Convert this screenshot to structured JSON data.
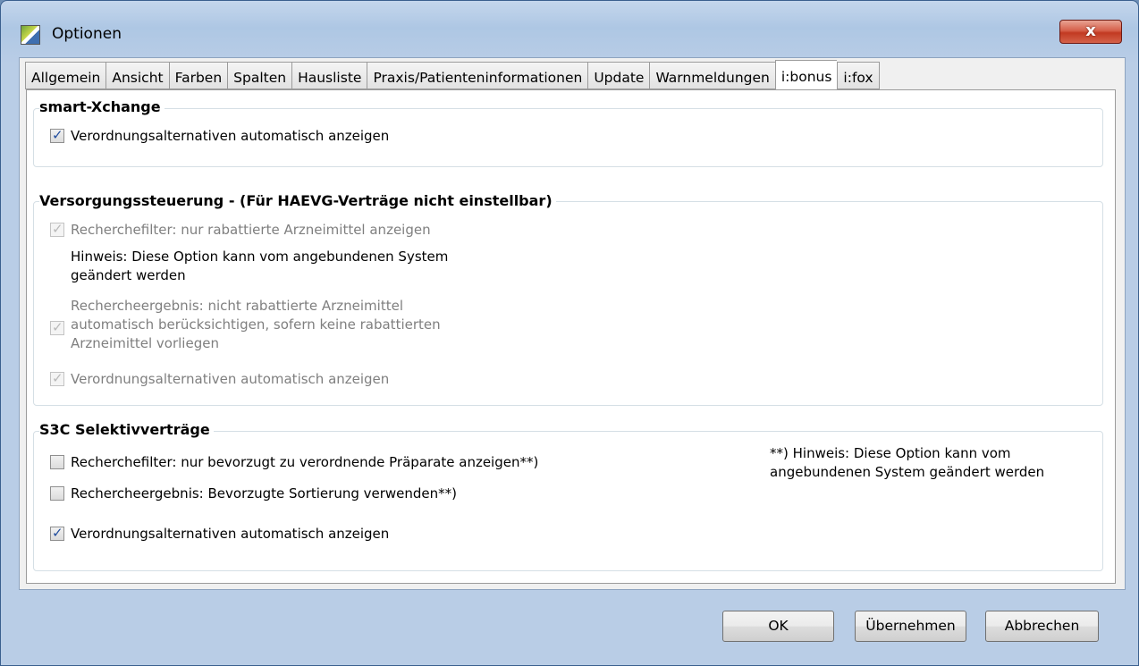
{
  "window": {
    "title": "Optionen",
    "close_label": "x"
  },
  "tabs": [
    {
      "label": "Allgemein",
      "active": false
    },
    {
      "label": "Ansicht",
      "active": false
    },
    {
      "label": "Farben",
      "active": false
    },
    {
      "label": "Spalten",
      "active": false
    },
    {
      "label": "Hausliste",
      "active": false
    },
    {
      "label": "Praxis/Patienteninformationen",
      "active": false
    },
    {
      "label": "Update",
      "active": false
    },
    {
      "label": "Warnmeldungen",
      "active": false
    },
    {
      "label": "i:bonus",
      "active": true
    },
    {
      "label": "i:fox",
      "active": false
    }
  ],
  "smart_xchange": {
    "title": "smart-Xchange",
    "option1": {
      "label": "Verordnungsalternativen automatisch anzeigen",
      "checked": true
    }
  },
  "versorgung": {
    "title": "Versorgungssteuerung - (Für HAEVG-Verträge nicht einstellbar)",
    "option1": {
      "label": "Recherchefilter: nur rabattierte Arzneimittel anzeigen",
      "checked": true,
      "enabled": false
    },
    "hint_line1": "Hinweis: Diese Option kann vom angebundenen System",
    "hint_line2": "geändert werden",
    "option2_line1": "Rechercheergebnis: nicht rabattierte Arzneimittel",
    "option2_line2": "automatisch berücksichtigen, sofern keine rabattierten",
    "option2_line3": "Arzneimittel vorliegen",
    "option3": {
      "label": "Verordnungsalternativen automatisch anzeigen",
      "checked": true,
      "enabled": false
    }
  },
  "s3c": {
    "title": "S3C Selektivverträge",
    "option1": {
      "label": "Recherchefilter: nur bevorzugt zu verordnende Präparate anzeigen**)",
      "checked": false
    },
    "option2": {
      "label": "Rechercheergebnis: Bevorzugte Sortierung verwenden**)",
      "checked": false
    },
    "option3": {
      "label": "Verordnungsalternativen automatisch anzeigen",
      "checked": true
    },
    "note_line1": "**) Hinweis: Diese Option kann vom",
    "note_line2": "angebundenen System geändert werden"
  },
  "buttons": {
    "ok": "OK",
    "apply": "Übernehmen",
    "cancel": "Abbrechen"
  }
}
